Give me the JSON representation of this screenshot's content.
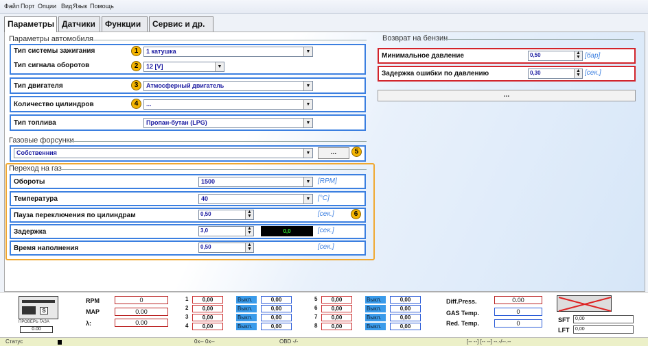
{
  "menu": [
    "Файл",
    "Порт",
    "Опции",
    "Вид",
    "Язык",
    "Помощь"
  ],
  "tabs": [
    "Параметры",
    "Датчики",
    "Функции",
    "Сервис и др."
  ],
  "car_params": {
    "title": "Параметры автомобиля",
    "ignition_label": "Тип системы зажигания",
    "ignition_value": "1 катушка",
    "rpm_signal_label": "Тип сигнала оборотов",
    "rpm_signal_value": "12 [V]",
    "engine_label": "Тип двигателя",
    "engine_value": "Атмосферный двигатель",
    "cylinders_label": "Количество цилиндров",
    "cylinders_value": "...",
    "fuel_label": "Тип топлива",
    "fuel_value": "Пропан-бутан (LPG)"
  },
  "injectors": {
    "title": "Газовые форсунки",
    "value": "Собственния",
    "button": "..."
  },
  "switch": {
    "title": "Переход на газ",
    "rpm_label": "Обороты",
    "rpm_value": "1500",
    "rpm_unit": "[RPM]",
    "temp_label": "Температура",
    "temp_value": "40",
    "temp_unit": "[°C]",
    "pause_label": "Пауза переключения по цилиндрам",
    "pause_value": "0,50",
    "pause_unit": "[сек.]",
    "delay_label": "Задержка",
    "delay_value": "3,0",
    "delay_display": "0,0",
    "delay_unit": "[сек.]",
    "fill_label": "Время наполнения",
    "fill_value": "0,50",
    "fill_unit": "[сек.]"
  },
  "return": {
    "title": "Возврат на бензин",
    "min_pressure_label": "Минимальное давление",
    "min_pressure_value": "0,50",
    "min_pressure_unit": "[бар]",
    "error_delay_label": "Задержка ошибки по давлению",
    "error_delay_value": "0,30",
    "error_delay_unit": "[сек.]",
    "button": "..."
  },
  "badges": [
    "1",
    "2",
    "3",
    "4",
    "5",
    "6"
  ],
  "bottom": {
    "rpm_label": "RPM",
    "rpm": "0",
    "map_label": "MAP",
    "map": "0.00",
    "lambda_label": "λ:",
    "lambda": "0.00",
    "ecu_label": "ПРОВЕРЬ ГАЗА",
    "ecu_value": "0.00",
    "ecu_s": "S",
    "inj": [
      {
        "n": "1",
        "v": "0,00",
        "s": "Выкл.",
        "v2": "0,00"
      },
      {
        "n": "2",
        "v": "0,00",
        "s": "Выкл.",
        "v2": "0,00"
      },
      {
        "n": "3",
        "v": "0,00",
        "s": "Выкл.",
        "v2": "0,00"
      },
      {
        "n": "4",
        "v": "0,00",
        "s": "Выкл.",
        "v2": "0,00"
      },
      {
        "n": "5",
        "v": "0,00",
        "s": "Выкл.",
        "v2": "0,00"
      },
      {
        "n": "6",
        "v": "0,00",
        "s": "Выкл.",
        "v2": "0,00"
      },
      {
        "n": "7",
        "v": "0,00",
        "s": "Выкл.",
        "v2": "0,00"
      },
      {
        "n": "8",
        "v": "0,00",
        "s": "Выкл.",
        "v2": "0,00"
      }
    ],
    "diff_label": "Diff.Press.",
    "diff": "0.00",
    "gas_label": "GAS Temp.",
    "gas": "0",
    "red_label": "Red. Temp.",
    "red": "0",
    "sft_label": "SFT",
    "sft": "0,00",
    "lft_label": "LFT",
    "lft": "0,00"
  },
  "status": {
    "label": "Статус",
    "ox": "0x-- 0x--",
    "obd": "OBD -/-",
    "right": "[-- --] [-- --] --.-/--.--"
  },
  "colors": {
    "blue_border": "#3b7fe0",
    "red_border": "#d2232a",
    "orange": "#f0a830",
    "badge": "#f4b400"
  }
}
